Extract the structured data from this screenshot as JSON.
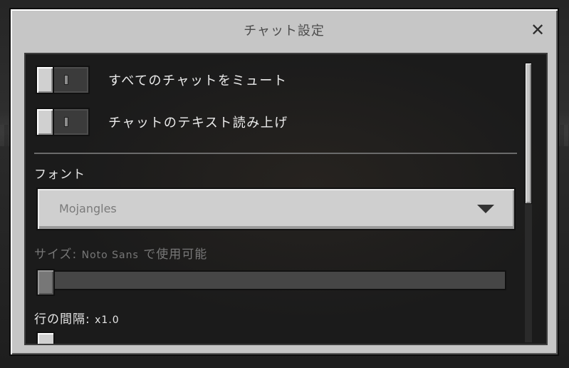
{
  "dialog": {
    "title": "チャット設定",
    "close_label": "✕"
  },
  "toggles": [
    {
      "label": "すべてのチャットをミュート",
      "on": false
    },
    {
      "label": "チャットのテキスト読み上げ",
      "on": false
    }
  ],
  "font": {
    "label": "フォント",
    "selected": "Mojangles"
  },
  "size": {
    "label_prefix": "サイズ: ",
    "label_font": "Noto Sans",
    "label_suffix": " で使用可能",
    "disabled": true
  },
  "line_spacing": {
    "label": "行の間隔: ",
    "value": "x1.0"
  }
}
